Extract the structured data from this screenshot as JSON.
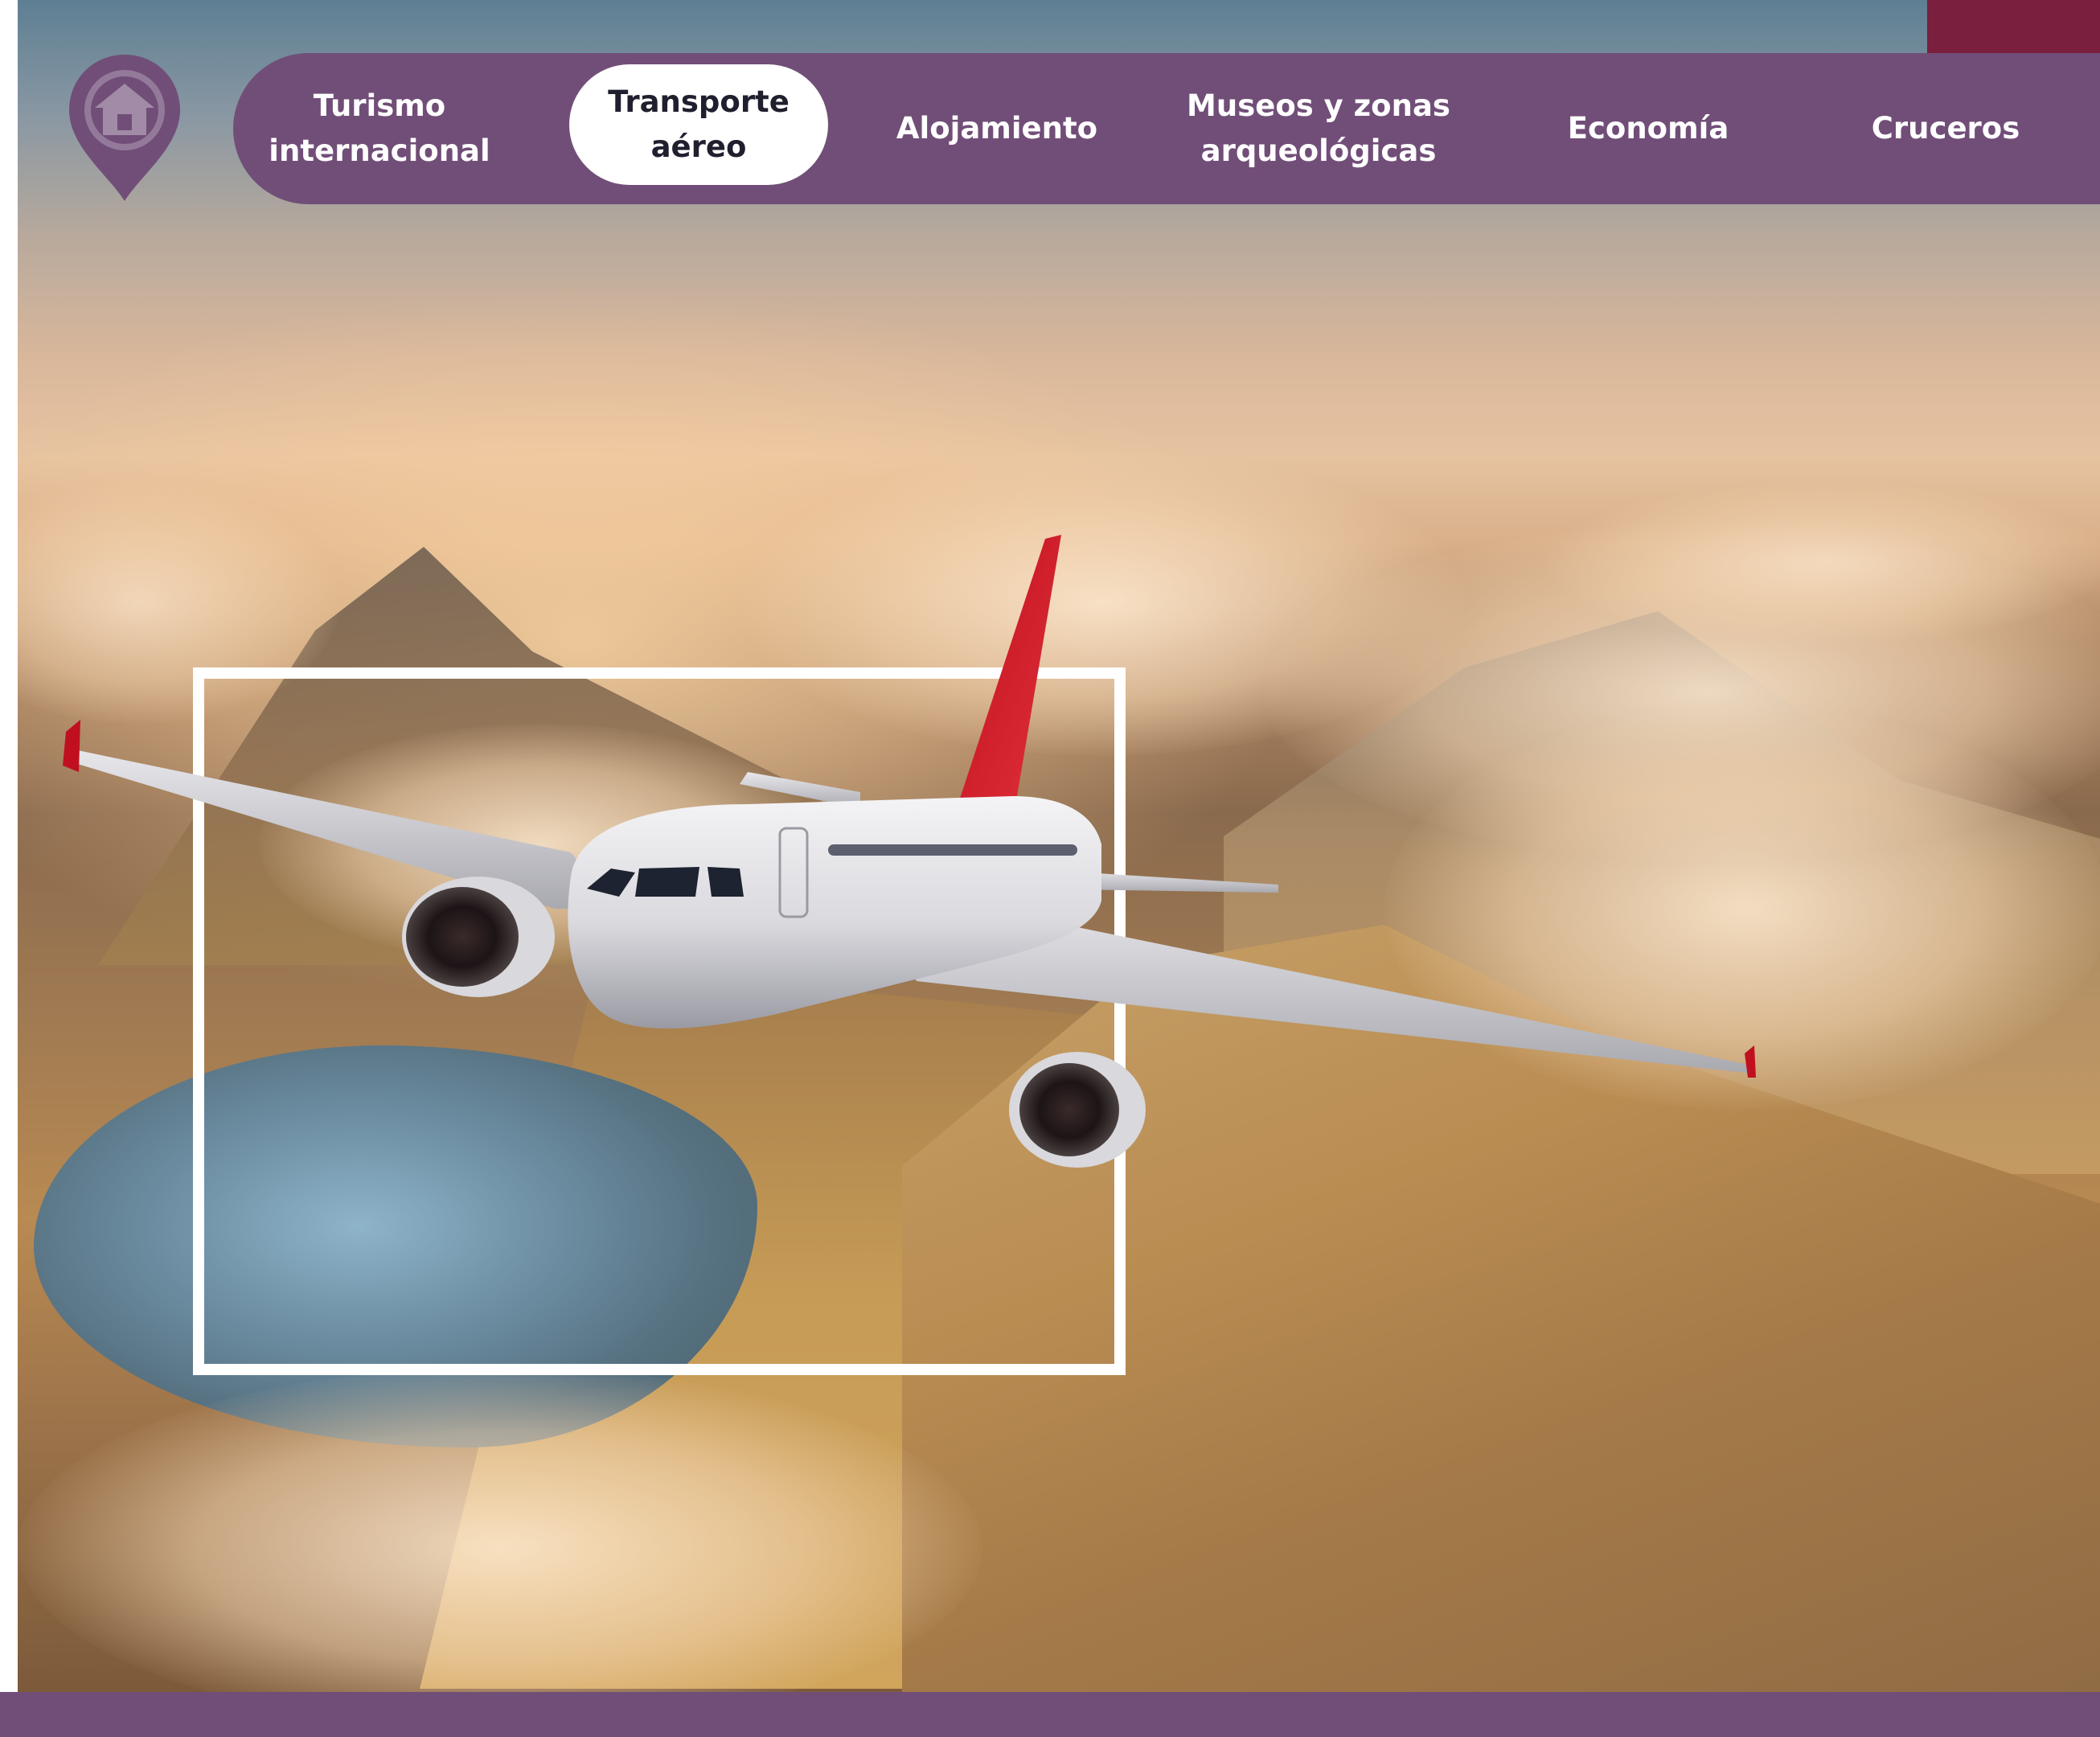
{
  "nav": {
    "items": [
      {
        "label": "Turismo internacional",
        "line1": "Turismo",
        "line2": "internacional",
        "active": false
      },
      {
        "label": "Transporte aéreo",
        "line1": "Transporte",
        "line2": "aéreo",
        "active": true
      },
      {
        "label": "Alojamiento",
        "line1": "Alojamiento",
        "line2": "",
        "active": false
      },
      {
        "label": "Museos y zonas arqueológicas",
        "line1": "Museos y zonas",
        "line2": "arqueológicas",
        "active": false
      },
      {
        "label": "Economía",
        "line1": "Economía",
        "line2": "",
        "active": false
      },
      {
        "label": "Cruceros",
        "line1": "Cruceros",
        "line2": "",
        "active": false
      }
    ],
    "active_index": 1
  },
  "home_button": {
    "icon": "home-pin-icon"
  },
  "hero": {
    "image": "airplane-over-mountains-photo"
  },
  "colors": {
    "nav_background": "#714e78",
    "accent": "#7a1f3d",
    "active_item_background": "#ffffff",
    "active_item_text": "#1f1f2e",
    "nav_text": "#ffffff"
  }
}
